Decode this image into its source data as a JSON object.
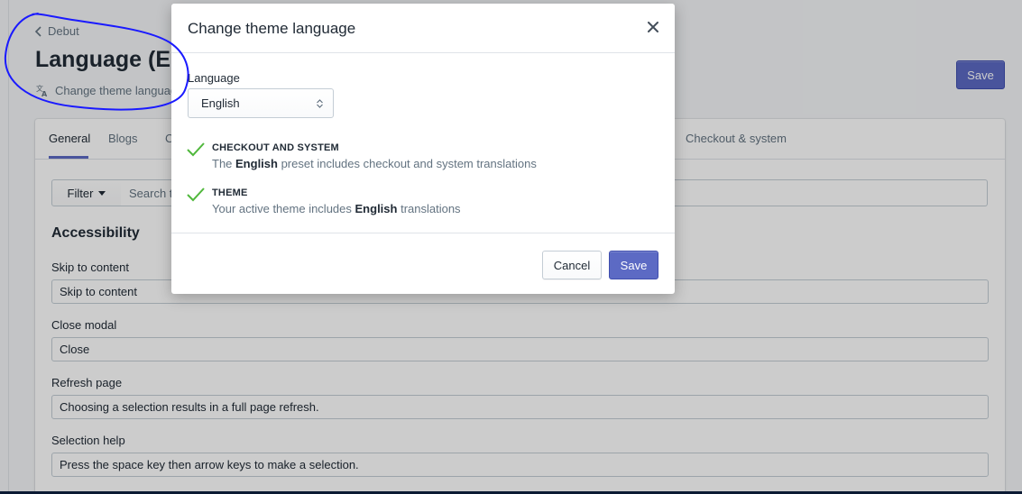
{
  "page": {
    "breadcrumb": "Debut",
    "title": "Language (English)",
    "subtitle": "Change theme language",
    "save_label": "Save",
    "tabs": [
      {
        "label": "General",
        "active": true
      },
      {
        "label": "Blogs",
        "active": false
      },
      {
        "label": "Cart",
        "active": false
      },
      {
        "label": "Checkout & system",
        "active": false
      }
    ],
    "filter_label": "Filter",
    "search_placeholder": "Search translations",
    "section_heading": "Accessibility",
    "fields": [
      {
        "label": "Skip to content",
        "value": "Skip to content"
      },
      {
        "label": "Close modal",
        "value": "Close"
      },
      {
        "label": "Refresh page",
        "value": "Choosing a selection results in a full page refresh."
      },
      {
        "label": "Selection help",
        "value": "Press the space key then arrow keys to make a selection."
      }
    ]
  },
  "modal": {
    "title": "Change theme language",
    "language_label": "Language",
    "language_value": "English",
    "items": [
      {
        "title": "CHECKOUT AND SYSTEM",
        "desc_prefix": "The ",
        "desc_bold": "English",
        "desc_suffix": " preset includes checkout and system translations"
      },
      {
        "title": "THEME",
        "desc_prefix": "Your active theme includes ",
        "desc_bold": "English",
        "desc_suffix": " translations"
      }
    ],
    "cancel_label": "Cancel",
    "save_label": "Save"
  },
  "colors": {
    "primary": "#5c6ac4",
    "check": "#50b83c",
    "annotation": "#1a1aff",
    "overlay": "rgba(0,0,0,0.2)"
  },
  "icons": {
    "breadcrumb": "chevron-left-icon",
    "subtitle": "translate-icon",
    "filter": "caret-down-icon",
    "close": "close-icon",
    "select": "select-arrows-icon",
    "check": "checkmark-icon"
  }
}
